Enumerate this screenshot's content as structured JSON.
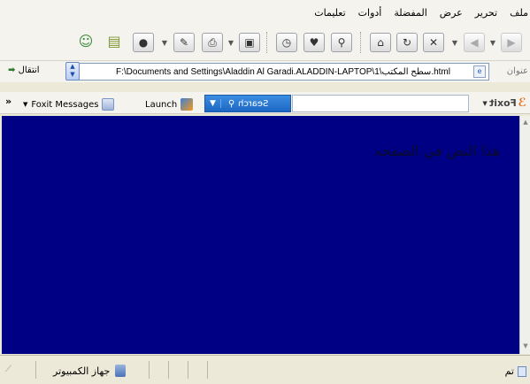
{
  "menu": {
    "items": [
      "ملف",
      "تحرير",
      "عرض",
      "المفضلة",
      "أدوات",
      "تعليمات"
    ]
  },
  "toolbar": {
    "back_icon": "back-arrow-icon",
    "forward_icon": "forward-arrow-icon",
    "stop_icon": "stop-x-icon",
    "refresh_icon": "refresh-icon",
    "home_icon": "home-icon",
    "search_icon": "search-icon",
    "favorites_icon": "heart-icon",
    "history_icon": "history-icon",
    "media_icon": "media-icon",
    "print_icon": "printer-icon",
    "edit_icon": "edit-icon",
    "discuss_icon": "discuss-icon",
    "research_icon": "research-icon",
    "messenger_icon": "messenger-icon"
  },
  "address": {
    "label": "عنوان",
    "value": "F:\\Documents and Settings\\Aladdin Al Garadi.ALADDIN-LAPTOP\\سطح المكتب\\1.html",
    "go_label": "انتقال"
  },
  "foxit": {
    "logo_text": "Foxit",
    "search_label": "Search",
    "launch_label": "Launch",
    "messages_label": "Foxit Messages",
    "chevron": "»"
  },
  "content": {
    "text": "هذا النص في الصفحه",
    "background": "#000085"
  },
  "status": {
    "done": "تم",
    "zone": "جهاز الكمبيوتر"
  }
}
